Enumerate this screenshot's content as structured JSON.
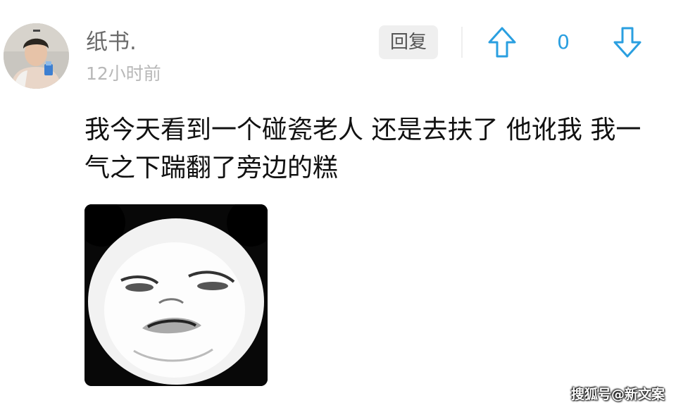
{
  "comment": {
    "username": "纸书.",
    "time": "12小时前",
    "reply_label": "回复",
    "vote_count": "0",
    "text": "我今天看到一个碰瓷老人 还是去扶了 他讹我 我一气之下踹翻了旁边的糕"
  },
  "icons": {
    "upvote": "arrow-up-icon",
    "downvote": "arrow-down-icon"
  },
  "colors": {
    "accent": "#2a9fe0",
    "username": "#6b6b6b",
    "time": "#b8b8b8",
    "reply_bg": "#efefef"
  },
  "watermark": "搜狐号@新文案"
}
